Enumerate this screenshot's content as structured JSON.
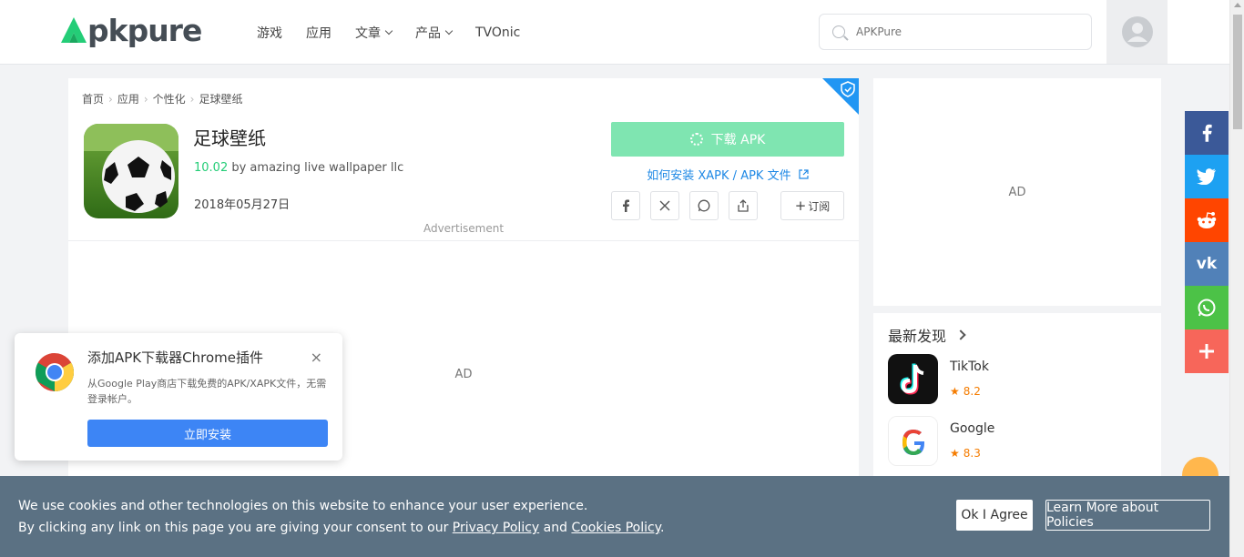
{
  "header": {
    "logo_text": "pkpure",
    "nav": [
      {
        "label": "游戏",
        "has_dropdown": false
      },
      {
        "label": "应用",
        "has_dropdown": false
      },
      {
        "label": "文章",
        "has_dropdown": true
      },
      {
        "label": "产品",
        "has_dropdown": true
      },
      {
        "label": "TVOnic",
        "has_dropdown": false
      }
    ],
    "search_placeholder": "APKPure"
  },
  "breadcrumb": [
    "首页",
    "应用",
    "个性化",
    "足球壁纸"
  ],
  "app": {
    "title": "足球壁纸",
    "version": "10.02",
    "by": "by amazing live wallpaper llc",
    "date": "2018年05月27日",
    "download_label": "下载 APK",
    "howto_label": "如何安装 XAPK / APK 文件",
    "subscribe_label": "订阅",
    "advert_label": "Advertisement",
    "ad_label": "AD"
  },
  "sidebar": {
    "ad_label": "AD",
    "discover_title": "最新发现",
    "items": [
      {
        "name": "TikTok",
        "rating": "8.2"
      },
      {
        "name": "Google",
        "rating": "8.3"
      }
    ]
  },
  "social_colors": {
    "facebook": "#3b5998",
    "twitter": "#1da1f2",
    "reddit": "#ff4500",
    "vk": "#5181b8",
    "whatsapp": "#4cc247",
    "more": "#f7665a"
  },
  "popup": {
    "title": "添加APK下载器Chrome插件",
    "desc": "从Google Play商店下载免费的APK/XAPK文件，无需登录帐户。",
    "install_label": "立即安装"
  },
  "cookie": {
    "line1": "We use cookies and other technologies on this website to enhance your user experience.",
    "line2_prefix": "By clicking any link on this page you are giving your consent to our ",
    "privacy_link": "Privacy Policy",
    "and": " and ",
    "cookies_link": "Cookies Policy",
    "period": ".",
    "ok_label": "Ok I Agree",
    "learn_label": "Learn More about Policies"
  }
}
